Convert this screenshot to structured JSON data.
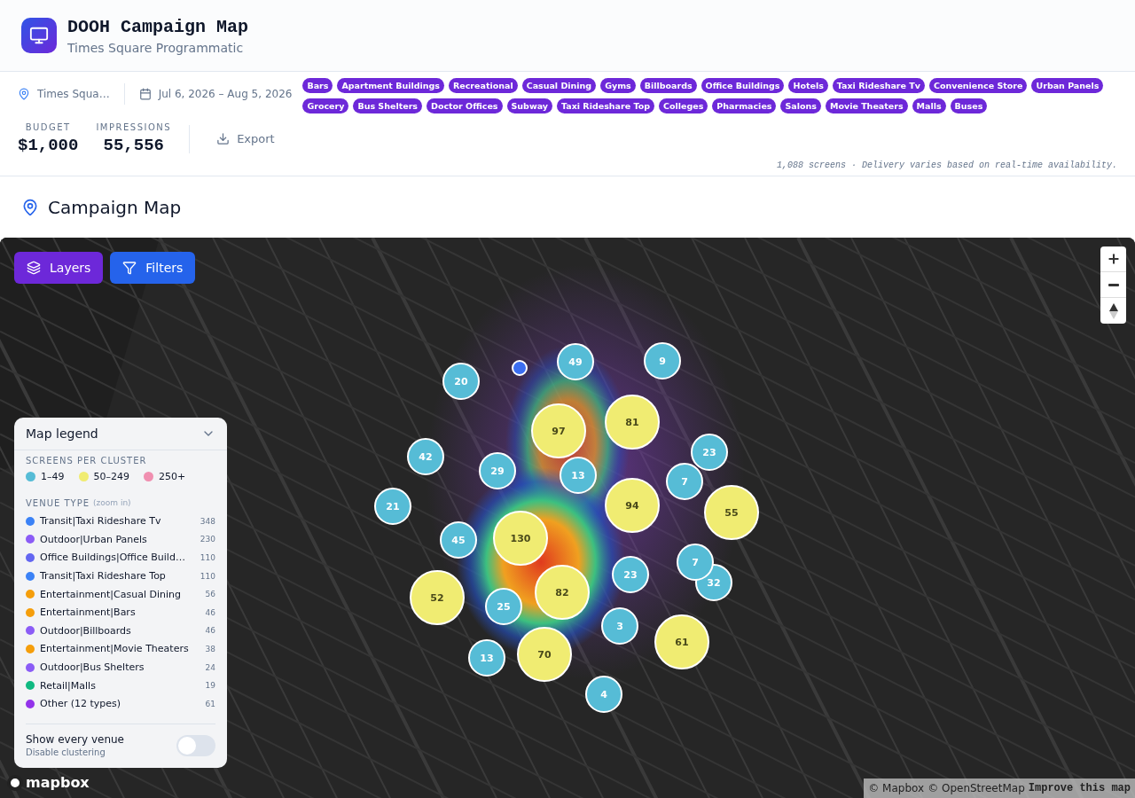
{
  "header": {
    "title": "DOOH Campaign Map",
    "subtitle": "Times Square Programmatic"
  },
  "filters": {
    "location": "Times Squa…",
    "dates": "Jul 6, 2026 – Aug 5, 2026",
    "tags": [
      "Bars",
      "Apartment Buildings",
      "Recreational",
      "Casual Dining",
      "Gyms",
      "Billboards",
      "Office Buildings",
      "Hotels",
      "Taxi Rideshare Tv",
      "Convenience Store",
      "Urban Panels",
      "Grocery",
      "Bus Shelters",
      "Doctor Offices",
      "Subway",
      "Taxi Rideshare Top",
      "Colleges",
      "Pharmacies",
      "Salons",
      "Movie Theaters",
      "Malls",
      "Buses"
    ]
  },
  "stats": [
    {
      "label": "BUDGET",
      "value": "$1,000"
    },
    {
      "label": "IMPRESSIONS",
      "value": "55,556"
    }
  ],
  "export_button": "Export",
  "note": "1,088 screens · Delivery varies based on real-time availability.",
  "section_title": "Campaign Map",
  "map": {
    "layers_button": "Layers",
    "filters_button": "Filters",
    "clusters": [
      {
        "count": "20",
        "kind": "small"
      },
      {
        "count": "49",
        "kind": "small"
      },
      {
        "count": "9",
        "kind": "small"
      },
      {
        "count": "97",
        "kind": "medium"
      },
      {
        "count": "81",
        "kind": "medium"
      },
      {
        "count": "42",
        "kind": "small"
      },
      {
        "count": "29",
        "kind": "small"
      },
      {
        "count": "13",
        "kind": "small"
      },
      {
        "count": "23",
        "kind": "small"
      },
      {
        "count": "7",
        "kind": "small"
      },
      {
        "count": "94",
        "kind": "medium"
      },
      {
        "count": "55",
        "kind": "medium"
      },
      {
        "count": "21",
        "kind": "small"
      },
      {
        "count": "45",
        "kind": "small"
      },
      {
        "count": "130",
        "kind": "medium"
      },
      {
        "count": "32",
        "kind": "small"
      },
      {
        "count": "7",
        "kind": "small"
      },
      {
        "count": "23",
        "kind": "small"
      },
      {
        "count": "52",
        "kind": "medium"
      },
      {
        "count": "25",
        "kind": "small"
      },
      {
        "count": "82",
        "kind": "medium"
      },
      {
        "count": "3",
        "kind": "small"
      },
      {
        "count": "61",
        "kind": "medium"
      },
      {
        "count": "13",
        "kind": "small"
      },
      {
        "count": "70",
        "kind": "medium"
      },
      {
        "count": "4",
        "kind": "small"
      }
    ],
    "legend": {
      "title": "Map legend",
      "cluster_heading": "SCREENS PER CLUSTER",
      "cluster_sizes": [
        {
          "label": "1–49",
          "color": "#56bcd6"
        },
        {
          "label": "50–249",
          "color": "#f0ec72"
        },
        {
          "label": "250+",
          "color": "#f08fb0"
        }
      ],
      "venue_heading": "VENUE TYPE",
      "venue_hint": "(zoom in)",
      "venues": [
        {
          "label": "Transit|Taxi Rideshare Tv",
          "count": "348",
          "color": "#3b82f6"
        },
        {
          "label": "Outdoor|Urban Panels",
          "count": "230",
          "color": "#8b5cf6"
        },
        {
          "label": "Office Buildings|Office Build…",
          "count": "110",
          "color": "#6366f1"
        },
        {
          "label": "Transit|Taxi Rideshare Top",
          "count": "110",
          "color": "#3b82f6"
        },
        {
          "label": "Entertainment|Casual Dining",
          "count": "56",
          "color": "#f59e0b"
        },
        {
          "label": "Entertainment|Bars",
          "count": "46",
          "color": "#f59e0b"
        },
        {
          "label": "Outdoor|Billboards",
          "count": "46",
          "color": "#8b5cf6"
        },
        {
          "label": "Entertainment|Movie Theaters",
          "count": "38",
          "color": "#f59e0b"
        },
        {
          "label": "Outdoor|Bus Shelters",
          "count": "24",
          "color": "#8b5cf6"
        },
        {
          "label": "Retail|Malls",
          "count": "19",
          "color": "#10b981"
        },
        {
          "label": "Other (12 types)",
          "count": "61",
          "color": "#9333ea"
        }
      ],
      "toggle": {
        "label": "Show every venue",
        "hint": "Disable clustering",
        "on": false
      }
    },
    "logo": "mapbox",
    "attribution": {
      "mapbox": "© Mapbox",
      "osm": "© OpenStreetMap",
      "improve": "Improve this map"
    }
  }
}
